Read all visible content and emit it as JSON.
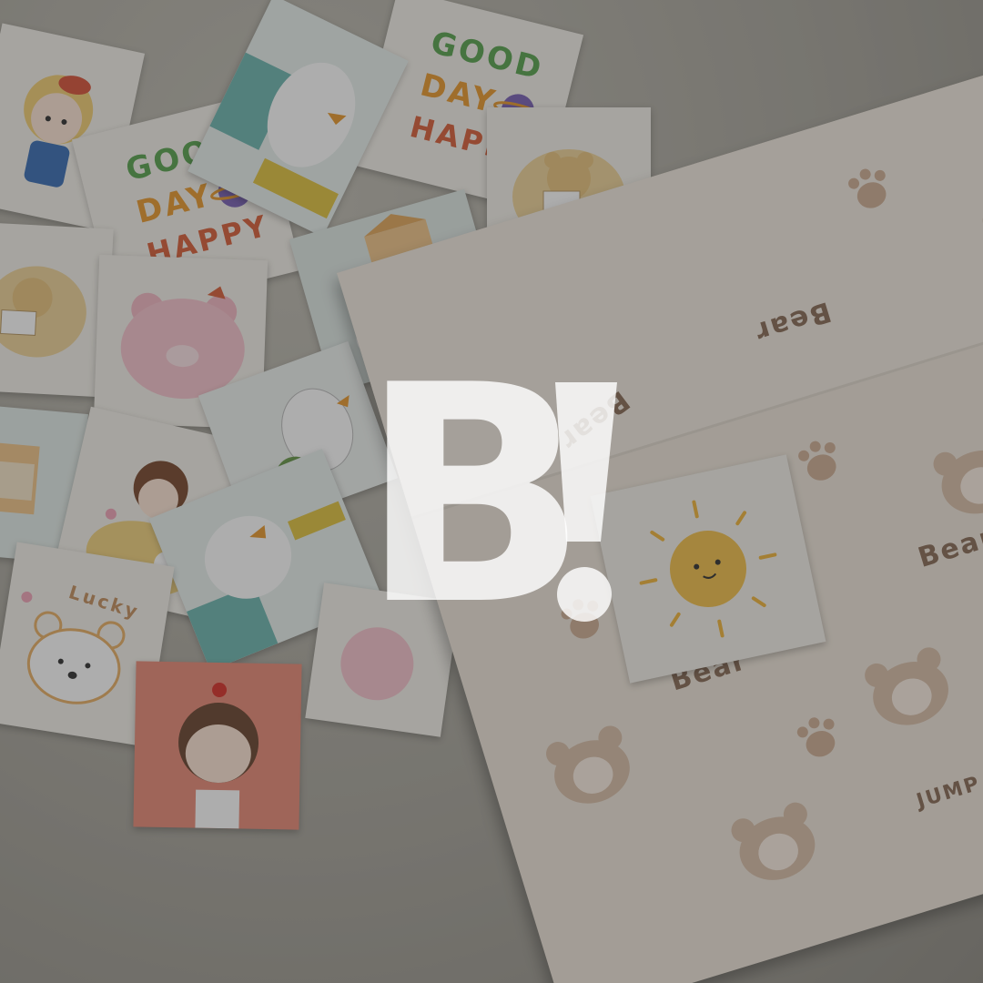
{
  "cards": {
    "good_day_1": {
      "line1": "GOOD",
      "line2": "DAY",
      "line3": "HAPPY"
    },
    "good_day_2": {
      "line1": "GOOD",
      "line2": "DAY",
      "line3": "HAPPY"
    },
    "lucky": {
      "label": "Lucky"
    }
  },
  "wrapping_paper": {
    "word": "Bear",
    "word_bottom": "JUMP"
  },
  "logo": {
    "text": "B",
    "bang": "!"
  },
  "colors": {
    "green": "#5aa350",
    "orange": "#e89a2f",
    "red": "#d8603a",
    "overlay": "#282828"
  }
}
